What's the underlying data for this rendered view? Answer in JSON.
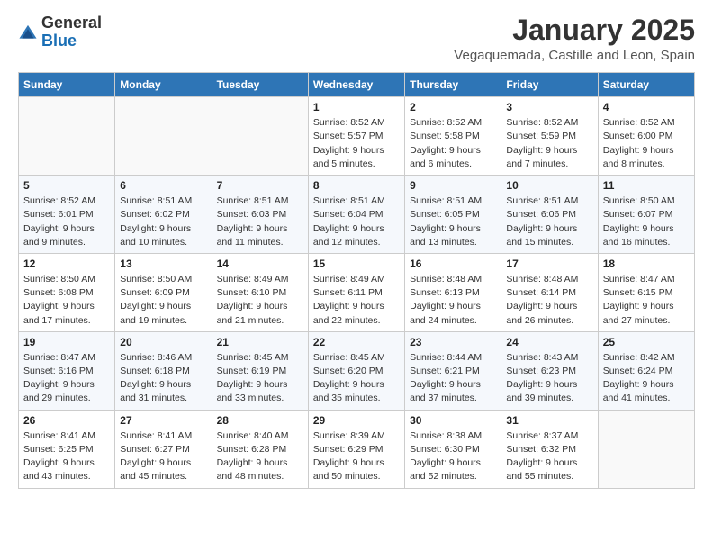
{
  "logo": {
    "general": "General",
    "blue": "Blue"
  },
  "header": {
    "title": "January 2025",
    "subtitle": "Vegaquemada, Castille and Leon, Spain"
  },
  "days_of_week": [
    "Sunday",
    "Monday",
    "Tuesday",
    "Wednesday",
    "Thursday",
    "Friday",
    "Saturday"
  ],
  "weeks": [
    [
      {
        "day": "",
        "sunrise": "",
        "sunset": "",
        "daylight": ""
      },
      {
        "day": "",
        "sunrise": "",
        "sunset": "",
        "daylight": ""
      },
      {
        "day": "",
        "sunrise": "",
        "sunset": "",
        "daylight": ""
      },
      {
        "day": "1",
        "sunrise": "Sunrise: 8:52 AM",
        "sunset": "Sunset: 5:57 PM",
        "daylight": "Daylight: 9 hours and 5 minutes."
      },
      {
        "day": "2",
        "sunrise": "Sunrise: 8:52 AM",
        "sunset": "Sunset: 5:58 PM",
        "daylight": "Daylight: 9 hours and 6 minutes."
      },
      {
        "day": "3",
        "sunrise": "Sunrise: 8:52 AM",
        "sunset": "Sunset: 5:59 PM",
        "daylight": "Daylight: 9 hours and 7 minutes."
      },
      {
        "day": "4",
        "sunrise": "Sunrise: 8:52 AM",
        "sunset": "Sunset: 6:00 PM",
        "daylight": "Daylight: 9 hours and 8 minutes."
      }
    ],
    [
      {
        "day": "5",
        "sunrise": "Sunrise: 8:52 AM",
        "sunset": "Sunset: 6:01 PM",
        "daylight": "Daylight: 9 hours and 9 minutes."
      },
      {
        "day": "6",
        "sunrise": "Sunrise: 8:51 AM",
        "sunset": "Sunset: 6:02 PM",
        "daylight": "Daylight: 9 hours and 10 minutes."
      },
      {
        "day": "7",
        "sunrise": "Sunrise: 8:51 AM",
        "sunset": "Sunset: 6:03 PM",
        "daylight": "Daylight: 9 hours and 11 minutes."
      },
      {
        "day": "8",
        "sunrise": "Sunrise: 8:51 AM",
        "sunset": "Sunset: 6:04 PM",
        "daylight": "Daylight: 9 hours and 12 minutes."
      },
      {
        "day": "9",
        "sunrise": "Sunrise: 8:51 AM",
        "sunset": "Sunset: 6:05 PM",
        "daylight": "Daylight: 9 hours and 13 minutes."
      },
      {
        "day": "10",
        "sunrise": "Sunrise: 8:51 AM",
        "sunset": "Sunset: 6:06 PM",
        "daylight": "Daylight: 9 hours and 15 minutes."
      },
      {
        "day": "11",
        "sunrise": "Sunrise: 8:50 AM",
        "sunset": "Sunset: 6:07 PM",
        "daylight": "Daylight: 9 hours and 16 minutes."
      }
    ],
    [
      {
        "day": "12",
        "sunrise": "Sunrise: 8:50 AM",
        "sunset": "Sunset: 6:08 PM",
        "daylight": "Daylight: 9 hours and 17 minutes."
      },
      {
        "day": "13",
        "sunrise": "Sunrise: 8:50 AM",
        "sunset": "Sunset: 6:09 PM",
        "daylight": "Daylight: 9 hours and 19 minutes."
      },
      {
        "day": "14",
        "sunrise": "Sunrise: 8:49 AM",
        "sunset": "Sunset: 6:10 PM",
        "daylight": "Daylight: 9 hours and 21 minutes."
      },
      {
        "day": "15",
        "sunrise": "Sunrise: 8:49 AM",
        "sunset": "Sunset: 6:11 PM",
        "daylight": "Daylight: 9 hours and 22 minutes."
      },
      {
        "day": "16",
        "sunrise": "Sunrise: 8:48 AM",
        "sunset": "Sunset: 6:13 PM",
        "daylight": "Daylight: 9 hours and 24 minutes."
      },
      {
        "day": "17",
        "sunrise": "Sunrise: 8:48 AM",
        "sunset": "Sunset: 6:14 PM",
        "daylight": "Daylight: 9 hours and 26 minutes."
      },
      {
        "day": "18",
        "sunrise": "Sunrise: 8:47 AM",
        "sunset": "Sunset: 6:15 PM",
        "daylight": "Daylight: 9 hours and 27 minutes."
      }
    ],
    [
      {
        "day": "19",
        "sunrise": "Sunrise: 8:47 AM",
        "sunset": "Sunset: 6:16 PM",
        "daylight": "Daylight: 9 hours and 29 minutes."
      },
      {
        "day": "20",
        "sunrise": "Sunrise: 8:46 AM",
        "sunset": "Sunset: 6:18 PM",
        "daylight": "Daylight: 9 hours and 31 minutes."
      },
      {
        "day": "21",
        "sunrise": "Sunrise: 8:45 AM",
        "sunset": "Sunset: 6:19 PM",
        "daylight": "Daylight: 9 hours and 33 minutes."
      },
      {
        "day": "22",
        "sunrise": "Sunrise: 8:45 AM",
        "sunset": "Sunset: 6:20 PM",
        "daylight": "Daylight: 9 hours and 35 minutes."
      },
      {
        "day": "23",
        "sunrise": "Sunrise: 8:44 AM",
        "sunset": "Sunset: 6:21 PM",
        "daylight": "Daylight: 9 hours and 37 minutes."
      },
      {
        "day": "24",
        "sunrise": "Sunrise: 8:43 AM",
        "sunset": "Sunset: 6:23 PM",
        "daylight": "Daylight: 9 hours and 39 minutes."
      },
      {
        "day": "25",
        "sunrise": "Sunrise: 8:42 AM",
        "sunset": "Sunset: 6:24 PM",
        "daylight": "Daylight: 9 hours and 41 minutes."
      }
    ],
    [
      {
        "day": "26",
        "sunrise": "Sunrise: 8:41 AM",
        "sunset": "Sunset: 6:25 PM",
        "daylight": "Daylight: 9 hours and 43 minutes."
      },
      {
        "day": "27",
        "sunrise": "Sunrise: 8:41 AM",
        "sunset": "Sunset: 6:27 PM",
        "daylight": "Daylight: 9 hours and 45 minutes."
      },
      {
        "day": "28",
        "sunrise": "Sunrise: 8:40 AM",
        "sunset": "Sunset: 6:28 PM",
        "daylight": "Daylight: 9 hours and 48 minutes."
      },
      {
        "day": "29",
        "sunrise": "Sunrise: 8:39 AM",
        "sunset": "Sunset: 6:29 PM",
        "daylight": "Daylight: 9 hours and 50 minutes."
      },
      {
        "day": "30",
        "sunrise": "Sunrise: 8:38 AM",
        "sunset": "Sunset: 6:30 PM",
        "daylight": "Daylight: 9 hours and 52 minutes."
      },
      {
        "day": "31",
        "sunrise": "Sunrise: 8:37 AM",
        "sunset": "Sunset: 6:32 PM",
        "daylight": "Daylight: 9 hours and 55 minutes."
      },
      {
        "day": "",
        "sunrise": "",
        "sunset": "",
        "daylight": ""
      }
    ]
  ]
}
